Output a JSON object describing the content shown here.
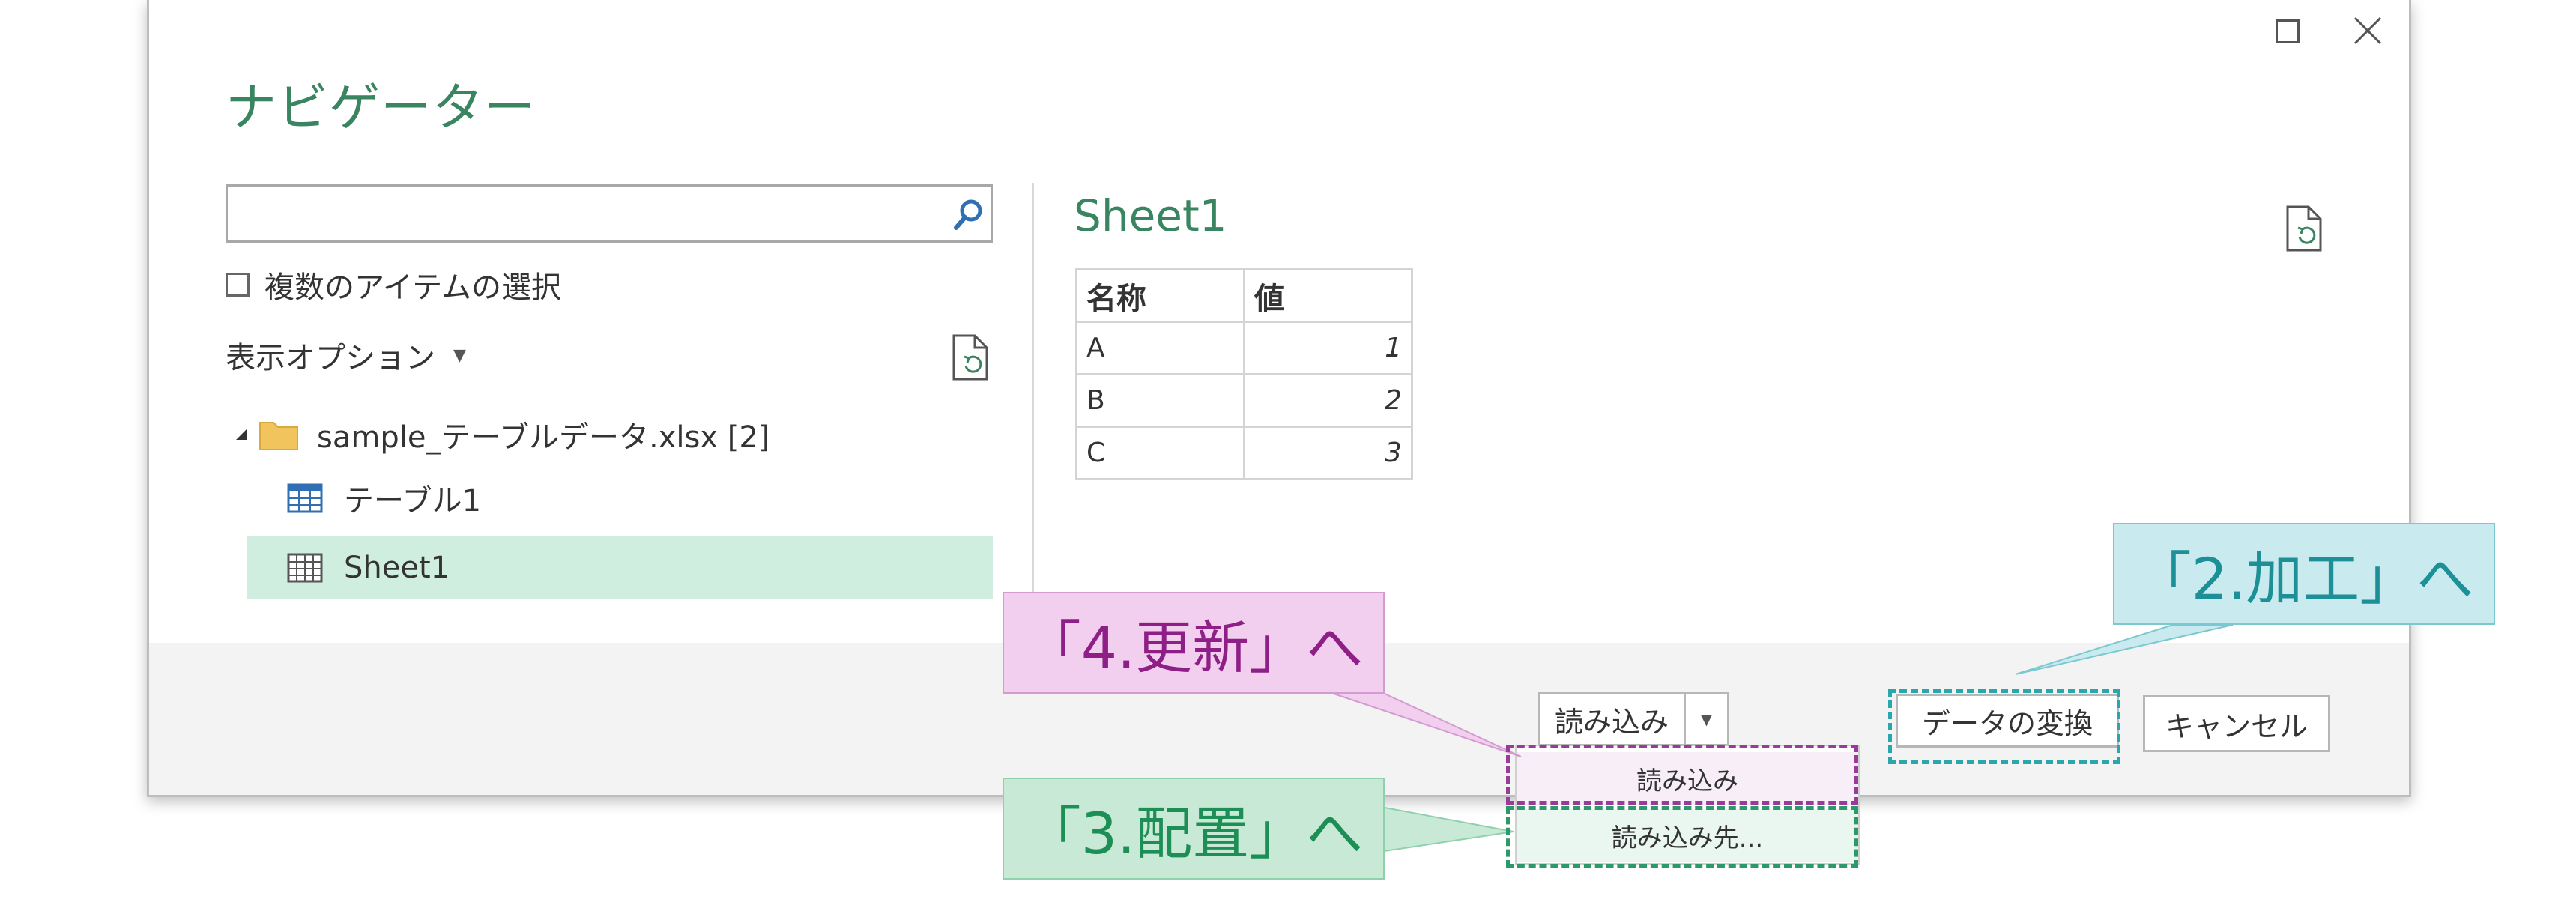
{
  "dialog": {
    "title": "ナビゲーター",
    "window_controls": [
      "maximize-icon",
      "close-icon"
    ]
  },
  "left_pane": {
    "search": {
      "value": "",
      "placeholder": "",
      "icon": "search-icon"
    },
    "multi_select_label": "複数のアイテムの選択",
    "multi_select_checked": false,
    "display_options_label": "表示オプション",
    "tree": {
      "file": {
        "label": "sample_テーブルデータ.xlsx [2]",
        "icon": "folder-icon",
        "expanded": true
      },
      "items": [
        {
          "label": "テーブル1",
          "icon": "table-icon",
          "selected": false
        },
        {
          "label": "Sheet1",
          "icon": "sheet-icon",
          "selected": true
        }
      ]
    }
  },
  "preview": {
    "title": "Sheet1",
    "columns": [
      "名称",
      "値"
    ],
    "rows": [
      [
        "A",
        "1"
      ],
      [
        "B",
        "2"
      ],
      [
        "C",
        "3"
      ]
    ]
  },
  "footer": {
    "load_button": "読み込み",
    "transform_button": "データの変換",
    "cancel_button": "キャンセル"
  },
  "load_menu": {
    "items": [
      "読み込み",
      "読み込み先..."
    ]
  },
  "callouts": {
    "transform": "「2.加工」へ",
    "load": "「4.更新」へ",
    "load_to": "「3.配置」へ"
  },
  "colors": {
    "title_green": "#3a8561",
    "selected_row": "#d0eee0",
    "callout_transform": "#c9eaee",
    "callout_load": "#f2cfee",
    "callout_load_to": "#c8e9d6",
    "dash_transform": "#2aa7ad",
    "dash_load": "#9c3a9c",
    "dash_load_to": "#2b9a68"
  }
}
